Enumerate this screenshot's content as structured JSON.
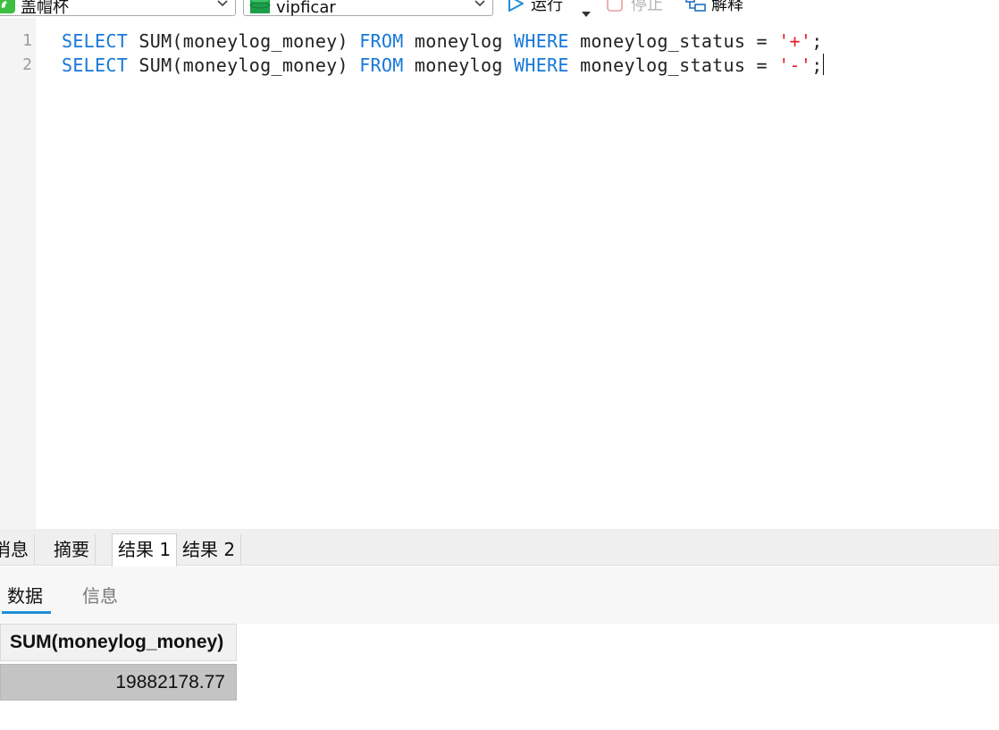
{
  "toolbar": {
    "connection_value": "盖帽杯",
    "database_value": "vipficar",
    "run_label": "运行",
    "stop_label": "停止",
    "explain_label": "解释"
  },
  "editor": {
    "line_numbers": [
      "1",
      "2"
    ],
    "lines": [
      {
        "kw1": "SELECT",
        "fn": " SUM(moneylog_money) ",
        "kw2": "FROM",
        "tbl": " moneylog ",
        "kw3": "WHERE",
        "cond": " moneylog_status = ",
        "str": "'+'",
        "end": ";"
      },
      {
        "kw1": "SELECT",
        "fn": " SUM(moneylog_money) ",
        "kw2": "FROM",
        "tbl": " moneylog ",
        "kw3": "WHERE",
        "cond": " moneylog_status = ",
        "str": "'-'",
        "end": ";"
      }
    ]
  },
  "result_tabs": [
    "消息",
    "摘要",
    "结果 1",
    "结果 2"
  ],
  "active_result_tab": "结果 1",
  "sub_tabs": [
    "数据",
    "信息"
  ],
  "grid": {
    "column_header": "SUM(moneylog_money)",
    "rows": [
      [
        "19882178.77"
      ]
    ]
  },
  "colors": {
    "keyword": "#1778d8",
    "string": "#e0202c",
    "accent": "#1e90d6"
  }
}
